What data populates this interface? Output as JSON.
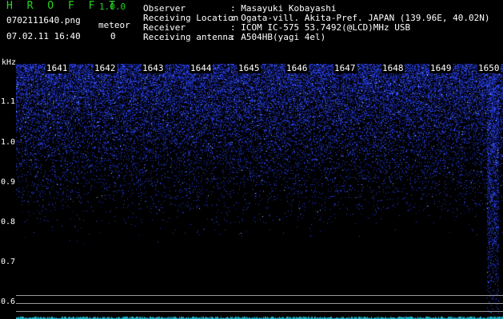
{
  "app": {
    "title": "H R O F F T",
    "version": "1.0.0"
  },
  "capture": {
    "filename": "0702111640.png",
    "datetime": "07.02.11 16:40",
    "meteor_label": "meteor",
    "meteor_count": "0"
  },
  "info": [
    {
      "label": "Observer",
      "value": ": Masayuki Kobayashi"
    },
    {
      "label": "Receiving Location",
      "value": ": Ogata-vill. Akita-Pref. JAPAN (139.96E, 40.02N)"
    },
    {
      "label": "Receiver",
      "value": ": ICOM IC-575 53.7492(@LCD)MHz USB"
    },
    {
      "label": "Receiving antenna",
      "value": ": A504HB(yagi 4el)"
    }
  ],
  "spectrogram": {
    "y_unit": "kHz",
    "y_ticks": [
      "1.1",
      "1.0",
      "0.9",
      "0.8",
      "0.7",
      "0.6"
    ],
    "x_ticks": [
      "1641",
      "1642",
      "1643",
      "1644",
      "1645",
      "1646",
      "1647",
      "1648",
      "1649",
      "1650"
    ],
    "noise_color": "#2a3cff",
    "bright_color": "#8fd6ff"
  }
}
